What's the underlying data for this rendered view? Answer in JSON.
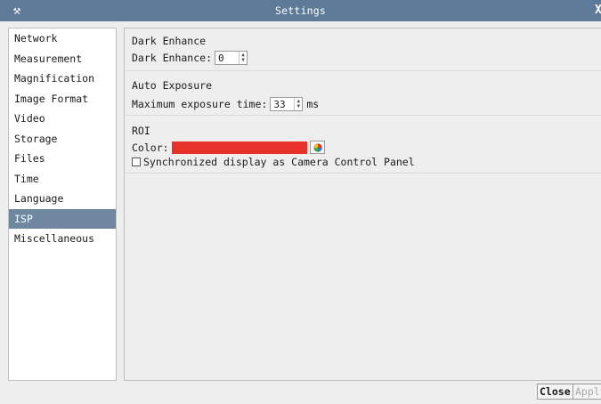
{
  "window": {
    "title": "Settings",
    "app_icon": "tools-icon",
    "close_label": "X"
  },
  "sidebar": {
    "items": [
      {
        "label": "Network",
        "selected": false
      },
      {
        "label": "Measurement",
        "selected": false
      },
      {
        "label": "Magnification",
        "selected": false
      },
      {
        "label": "Image Format",
        "selected": false
      },
      {
        "label": "Video",
        "selected": false
      },
      {
        "label": "Storage",
        "selected": false
      },
      {
        "label": "Files",
        "selected": false
      },
      {
        "label": "Time",
        "selected": false
      },
      {
        "label": "Language",
        "selected": false
      },
      {
        "label": "ISP",
        "selected": true
      },
      {
        "label": "Miscellaneous",
        "selected": false
      }
    ]
  },
  "main": {
    "dark_enhance": {
      "group_title": "Dark Enhance",
      "label": "Dark Enhance:",
      "value": "0"
    },
    "auto_exposure": {
      "group_title": "Auto Exposure",
      "label": "Maximum exposure time:",
      "value": "33",
      "unit": "ms"
    },
    "roi": {
      "group_title": "ROI",
      "color_label": "Color:",
      "color_value": "#e8332a",
      "sync_label": "Synchronized display as Camera Control Panel",
      "sync_checked": false
    }
  },
  "footer": {
    "close_label": "Close",
    "apply_label": "Apply",
    "apply_enabled": false
  }
}
